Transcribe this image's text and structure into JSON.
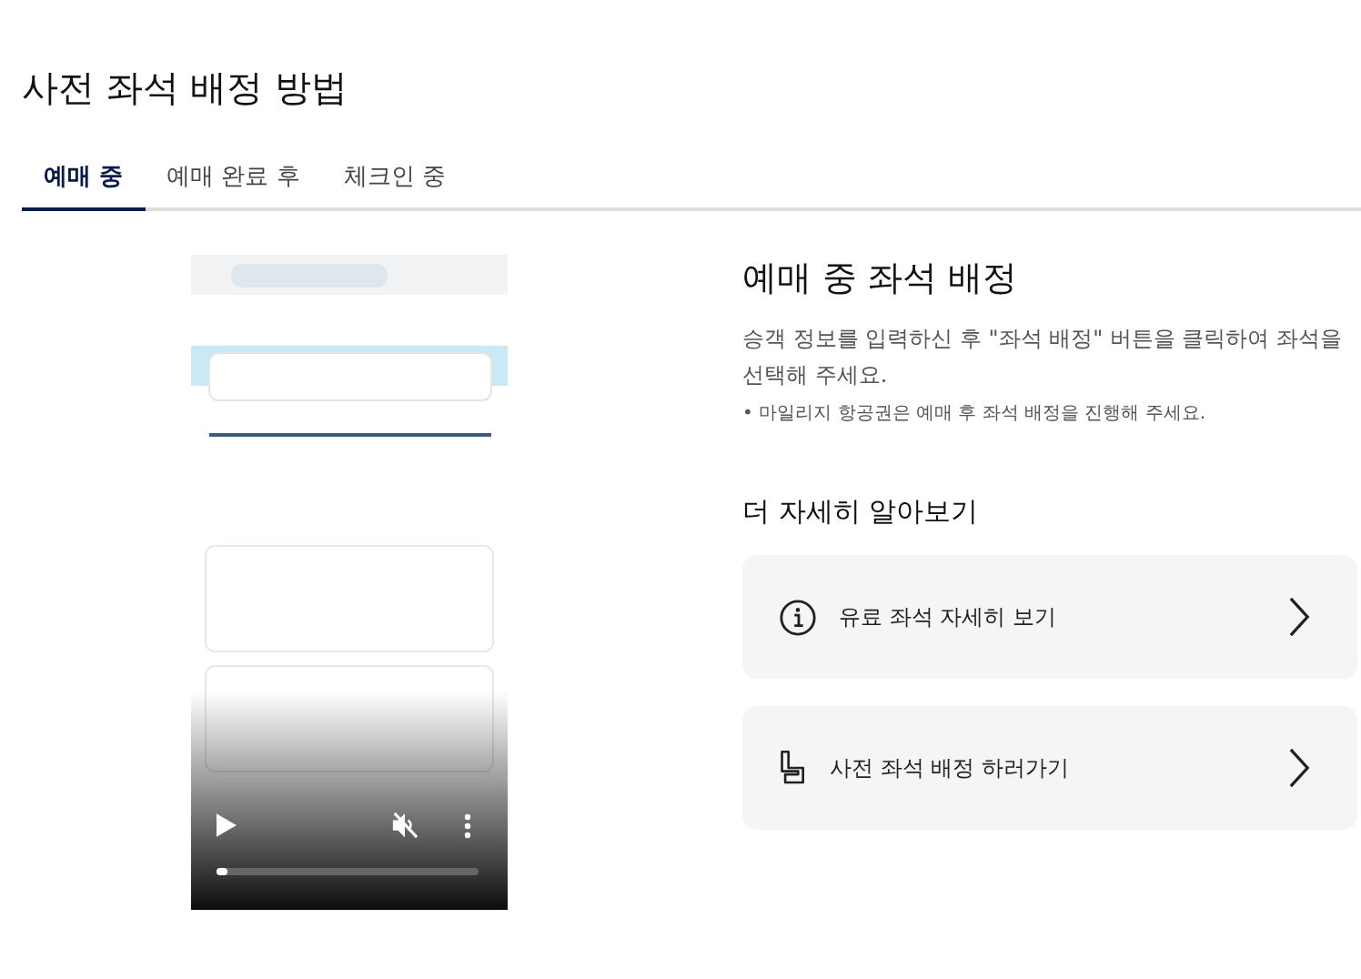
{
  "title": "사전 좌석 배정 방법",
  "tabs": [
    {
      "label": "예매 중",
      "selected": true
    },
    {
      "label": "예매 완료 후",
      "selected": false
    },
    {
      "label": "체크인 중",
      "selected": false
    }
  ],
  "video": {
    "kind": "picture",
    "progress": {
      "level": 0.04
    }
  },
  "section": {
    "heading": "예매 중 좌석 배정",
    "description": "승객 정보를 입력하신 후 \"좌석 배정\" 버튼을 클릭하여 좌석을 선택해 주세요.",
    "note": "• 마일리지 항공권은 예매 후 좌석 배정을 진행해 주세요."
  },
  "more": {
    "heading": "더 자세히 알아보기",
    "links": [
      {
        "kind": "info",
        "label": "유료 좌석 자세히 보기"
      },
      {
        "kind": "seat",
        "label": "사전 좌석 배정 하러가기"
      }
    ]
  }
}
